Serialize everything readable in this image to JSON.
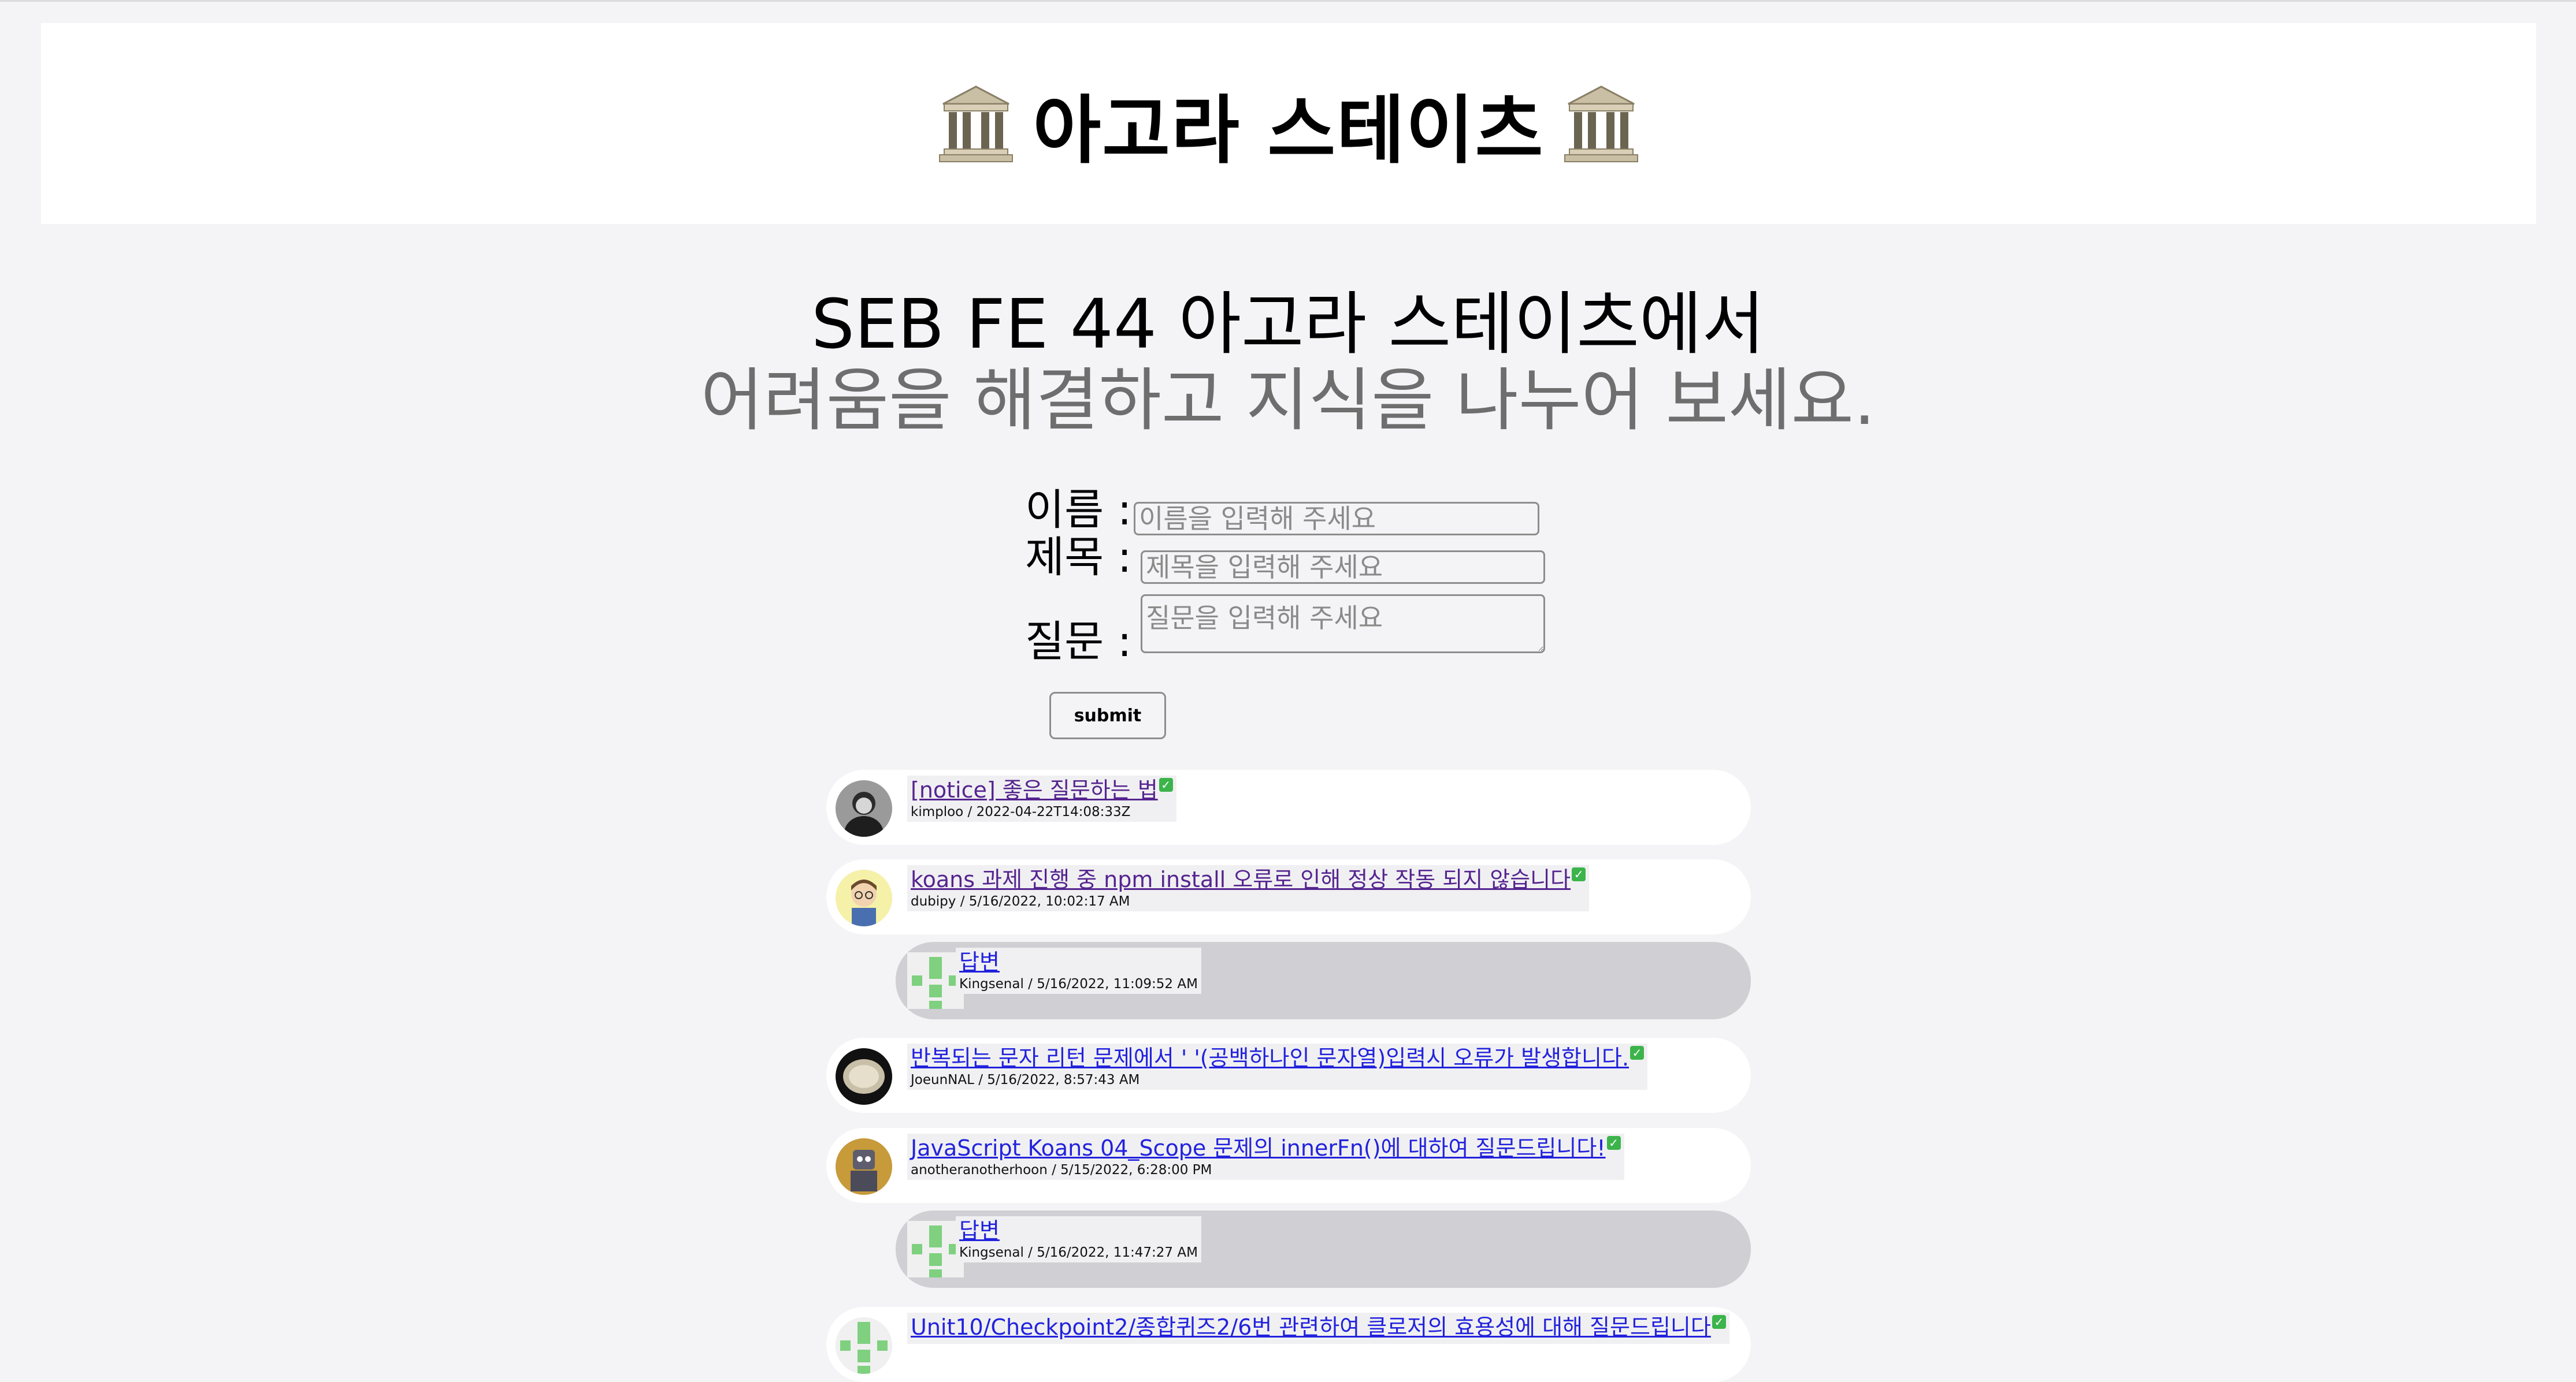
{
  "header": {
    "title": "아고라 스테이츠"
  },
  "hero": {
    "line1": "SEB FE 44 아고라 스테이츠에서",
    "line2": "어려움을 해결하고 지식을 나누어 보세요."
  },
  "form": {
    "name_label": "이름 :",
    "name_placeholder": "이름을 입력해 주세요",
    "title_label": "제목 :",
    "title_placeholder": "제목을 입력해 주세요",
    "question_label": "질문 :",
    "question_placeholder": "질문을 입력해 주세요",
    "submit_label": "submit"
  },
  "discussions": [
    {
      "title": "[notice] 좋은 질문하는 법",
      "meta": "kimploo / 2022-04-22T14:08:33Z",
      "answered": true,
      "visited": true,
      "avatar": "portrait-bw"
    },
    {
      "title": "koans 과제 진행 중 npm install 오류로 인해 정상 작동 되지 않습니다",
      "meta": "dubipy / 5/16/2022, 10:02:17 AM",
      "answered": true,
      "visited": true,
      "avatar": "cartoon-glasses",
      "answer": {
        "title": "답변",
        "meta": "Kingsenal / 5/16/2022, 11:09:52 AM"
      }
    },
    {
      "title": "반복되는 문자 리턴 문제에서 ' '(공백하나인 문자열)입력시 오류가 발생합니다.",
      "meta": "JoeunNAL / 5/16/2022, 8:57:43 AM",
      "answered": true,
      "visited": false,
      "avatar": "oyster"
    },
    {
      "title": "JavaScript Koans 04_Scope 문제의 innerFn()에 대하여 질문드립니다!",
      "meta": "anotheranotherhoon / 5/15/2022, 6:28:00 PM",
      "answered": true,
      "visited": false,
      "avatar": "robot",
      "answer": {
        "title": "답변",
        "meta": "Kingsenal / 5/16/2022, 11:47:27 AM"
      }
    },
    {
      "title": "Unit10/Checkpoint2/종합퀴즈2/6번 관련하여 클로저의 효용성에 대해 질문드립니다",
      "meta": "",
      "answered": true,
      "visited": false,
      "avatar": "identicon"
    }
  ],
  "colors": {
    "check": "#3cb44b",
    "link": "#2222dd",
    "visited": "#55248f",
    "answer_bg": "#cfcfd4"
  }
}
